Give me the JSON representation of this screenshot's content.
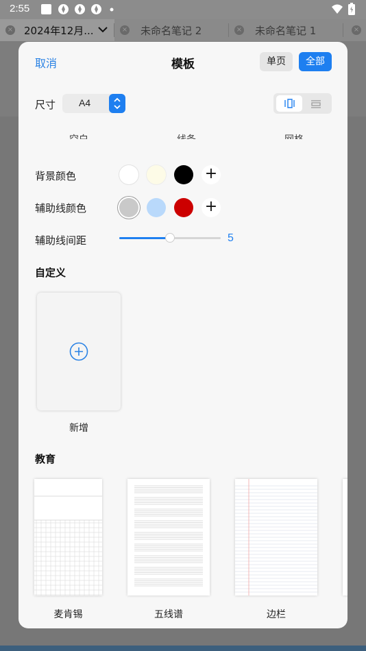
{
  "status_bar": {
    "time": "2:55",
    "icons": [
      "square-icon",
      "notification-icon",
      "notification-icon",
      "notification-icon",
      "dot-icon",
      "wifi-icon",
      "battery-icon"
    ]
  },
  "tabs": [
    {
      "label": "2024年12月...",
      "active": true
    },
    {
      "label": "未命名笔记 2",
      "active": false
    },
    {
      "label": "未命名笔记 1",
      "active": false
    }
  ],
  "sheet": {
    "cancel_label": "取消",
    "title": "模板",
    "single_page_label": "单页",
    "all_label": "全部",
    "size_label": "尺寸",
    "size_value": "A4",
    "orientation_options": [
      "portrait-icon",
      "landscape-icon"
    ],
    "cut_row_labels": [
      "空白",
      "线条",
      "网格"
    ],
    "background_color_label": "背景颜色",
    "background_colors": [
      "#ffffff",
      "#fdfbe7",
      "#000000"
    ],
    "guide_color_label": "辅助线颜色",
    "guide_colors": [
      "#c9c9c9",
      "#b9d9fb",
      "#cc0000"
    ],
    "guide_spacing_label": "辅助线间距",
    "guide_spacing_value": "5",
    "guide_spacing_fraction": 0.5,
    "custom_section_title": "自定义",
    "new_label": "新增",
    "education_section_title": "教育",
    "education_templates": [
      "麦肯锡",
      "五线谱",
      "边栏"
    ]
  },
  "colors": {
    "accent": "#1e7ff0",
    "link": "#2a82e4"
  }
}
